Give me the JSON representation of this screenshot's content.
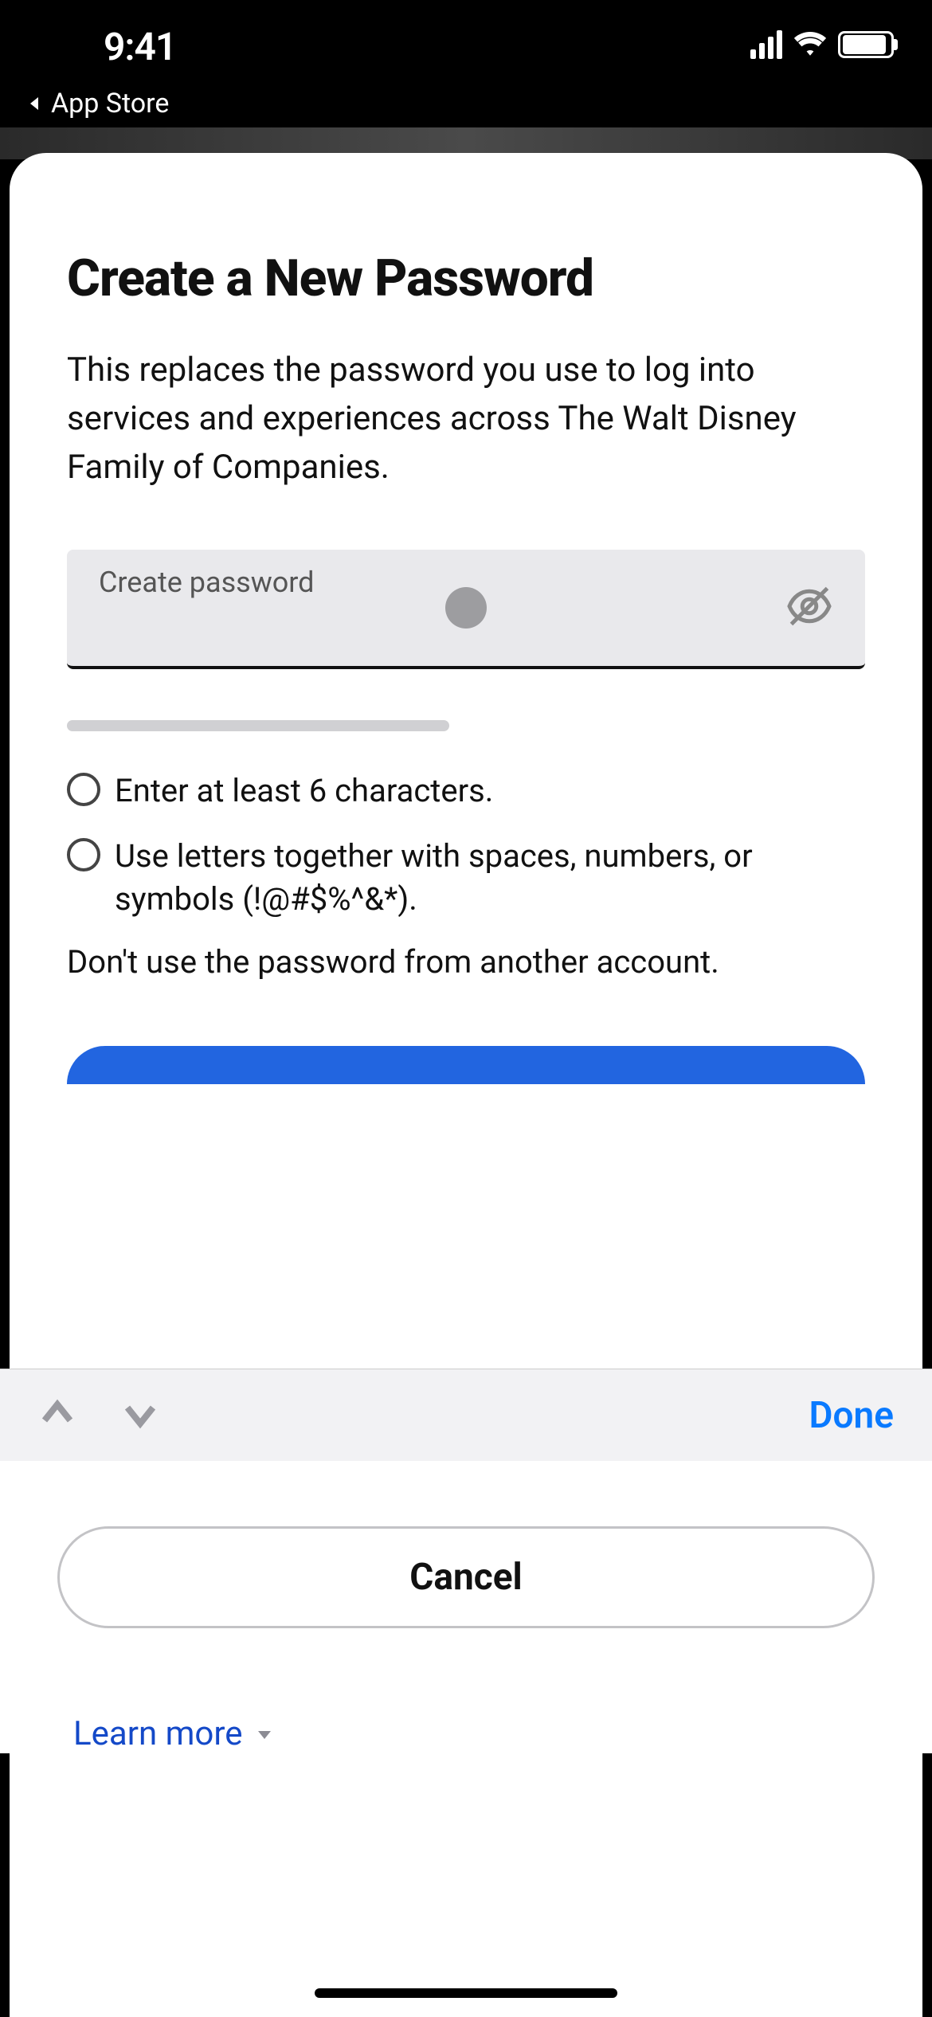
{
  "status_bar": {
    "time": "9:41",
    "back_app_label": "App Store"
  },
  "sheet": {
    "heading": "Create a New Password",
    "subtext": "This replaces the password you use to log into services and experiences across The Walt Disney Family of Companies."
  },
  "password_field": {
    "label": "Create password",
    "value": ""
  },
  "requirements": {
    "items": [
      "Enter at least 6 characters.",
      "Use letters together with spaces, numbers, or symbols (!@#$%^&*)."
    ],
    "note": "Don't use the password from another account."
  },
  "buttons": {
    "cancel": "Cancel",
    "learn_more": "Learn more"
  },
  "keyboard_accessory": {
    "done": "Done"
  }
}
